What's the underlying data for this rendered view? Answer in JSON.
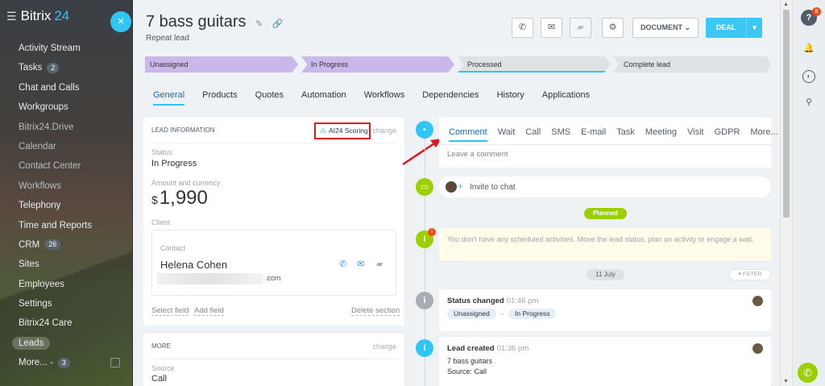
{
  "sidebar": {
    "logo": "Bitrix",
    "logo_num": "24",
    "close_glyph": "×",
    "items": [
      {
        "label": "Activity Stream",
        "count": ""
      },
      {
        "label": "Tasks",
        "count": "2"
      },
      {
        "label": "Chat and Calls",
        "count": ""
      },
      {
        "label": "Workgroups",
        "count": ""
      },
      {
        "label": "Bitrix24.Drive",
        "count": ""
      },
      {
        "label": "Calendar",
        "count": ""
      },
      {
        "label": "Contact Center",
        "count": ""
      },
      {
        "label": "Workflows",
        "count": ""
      },
      {
        "label": "Telephony",
        "count": ""
      },
      {
        "label": "Time and Reports",
        "count": ""
      },
      {
        "label": "CRM",
        "count": "26"
      },
      {
        "label": "Sites",
        "count": ""
      },
      {
        "label": "Employees",
        "count": ""
      },
      {
        "label": "Settings",
        "count": ""
      },
      {
        "label": "Bitrix24 Care",
        "count": ""
      },
      {
        "label": "Leads",
        "count": ""
      },
      {
        "label": "More... -",
        "count": "3"
      }
    ]
  },
  "header": {
    "title": "7 bass guitars",
    "subtitle": "Repeat lead",
    "document_label": "DOCUMENT",
    "deal_label": "DEAL"
  },
  "stages": [
    "Unassigned",
    "In Progress",
    "Processed",
    "Complete lead"
  ],
  "tabs": [
    "General",
    "Products",
    "Quotes",
    "Automation",
    "Workflows",
    "Dependencies",
    "History",
    "Applications"
  ],
  "lead_info": {
    "heading": "LEAD INFORMATION",
    "ai_scoring": "AI24 Scoring",
    "change": "change",
    "status_label": "Status",
    "status_value": "In Progress",
    "amount_label": "Amount and currency",
    "currency": "$",
    "amount": "1,990",
    "client_label": "Client",
    "contact_label": "Contact",
    "contact_name": "Helena Cohen",
    "email_domain": ".com",
    "select_field": "Select field",
    "add_field": "Add field",
    "delete_section": "Delete section"
  },
  "more": {
    "heading": "MORE",
    "change": "change",
    "source_label": "Source",
    "source_value": "Call"
  },
  "timeline": {
    "tabs": [
      "Comment",
      "Wait",
      "Call",
      "SMS",
      "E-mail",
      "Task",
      "Meeting",
      "Visit",
      "GDPR",
      "More... ▾"
    ],
    "comment_placeholder": "Leave a comment",
    "invite": "Invite to chat",
    "planned": "Planned",
    "no_activities": "You don't have any scheduled activities. Move the lead status, plan an activity or engage a wait.",
    "date": "11 July",
    "filter": "FILTER",
    "events": [
      {
        "title": "Status changed",
        "time": "01:46 pm",
        "from": "Unassigned",
        "to": "In Progress"
      },
      {
        "title": "Lead created",
        "time": "01:36 pm",
        "line1": "7 bass guitars",
        "line2": "Source: Call"
      }
    ]
  },
  "right_panel": {
    "help_badge": "8"
  },
  "colors": {
    "accent": "#2fc6f6",
    "stage_done": "#c9b8e9",
    "planned": "#9dcf00",
    "highlight": "#e0161d"
  }
}
